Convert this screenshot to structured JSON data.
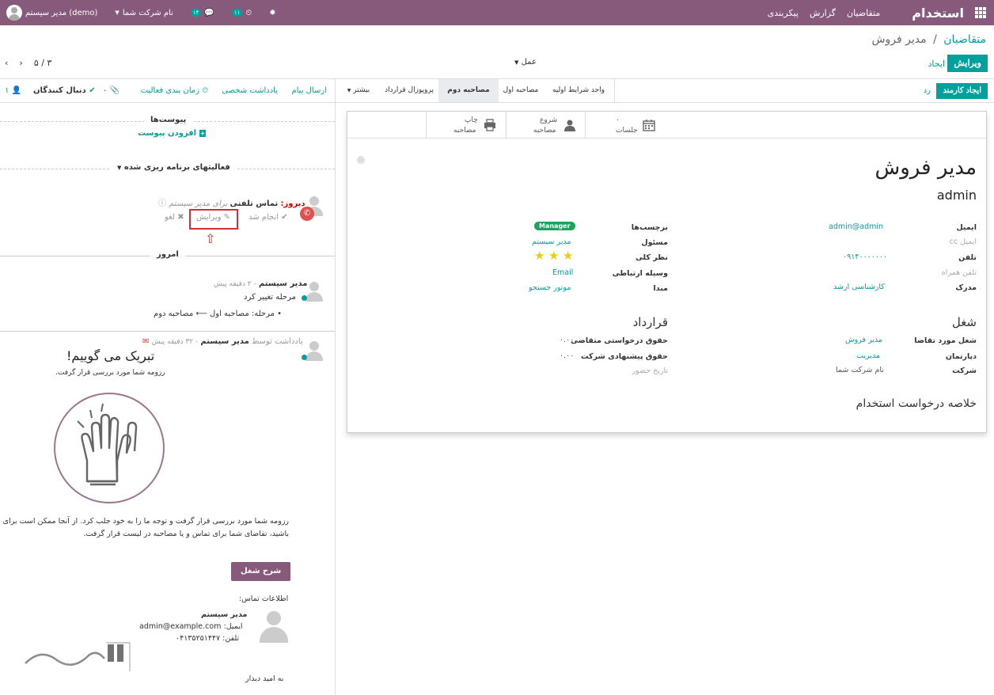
{
  "navbar": {
    "brand": "استخدام",
    "menu": [
      "متقاضیان",
      "گزارش",
      "پیکربندی"
    ],
    "company": "نام شرکت شما",
    "user": "مدیر سیستم (demo)",
    "messages_badge": "۱۴",
    "activities_badge": "۱۱"
  },
  "control": {
    "breadcrumb_parent": "متقاضیان",
    "breadcrumb_sep": "/",
    "breadcrumb_current": "مدیر فروش",
    "edit_label": "ویرایش",
    "create_label": "ایجاد",
    "action_label": "عمل",
    "pager": "۵ / ۳"
  },
  "statusbar": {
    "create_employee": "ایجاد کارمند",
    "refuse": "رد",
    "stages": [
      "واجد شرایط اولیه",
      "مصاحبه اول",
      "مصاحبه دوم",
      "پروپوزال قرارداد",
      "بیشتر"
    ],
    "active_stage": "مصاحبه دوم"
  },
  "smart_buttons": {
    "meetings_count": "۰",
    "meetings_label": "جلسات",
    "start_label1": "شروع",
    "start_label2": "مصاحبه",
    "print_label1": "چاپ",
    "print_label2": "مصاحبه"
  },
  "form": {
    "title": "مدیر فروش",
    "subject": "admin",
    "email_label": "ایمیل",
    "email_value": "admin@admin",
    "email_cc_label": "ایمیل cc",
    "phone_label": "تلفن",
    "phone_value": "۰۹۱۴۰۰۰۰۰۰۰",
    "mobile_label": "تلفن همراه",
    "degree_label": "مدرک",
    "degree_value": "کارشناسی ارشد",
    "tags_label": "برچسب‌ها",
    "tag_value": "Manager",
    "responsible_label": "مسئول",
    "responsible_value": "مدیر سیستم",
    "evaluation_label": "نظر کلی",
    "evaluation_stars": 3,
    "medium_label": "وسیله ارتباطی",
    "medium_value": "Email",
    "source_label": "مبدا",
    "source_value": "موتور جستجو",
    "job_section": "شغل",
    "job_label": "شغل مورد تقاضا",
    "job_value": "مدیر فروش",
    "department_label": "دپارتمان",
    "department_value": "مدیریت",
    "company_label": "شرکت",
    "company_value": "نام شرکت شما",
    "contract_section": "قرارداد",
    "expected_salary_label": "حقوق درخواستی متقاضی",
    "expected_salary_value": "۰.۰۰",
    "proposed_salary_label": "حقوق پیشنهادی شرکت",
    "proposed_salary_value": "۰.۰۰",
    "availability_label": "تاریخ حضور",
    "summary_section": "خلاصه درخواست استخدام"
  },
  "chatter": {
    "send_message": "ارسال پیام",
    "log_note": "یادداشت شخصی",
    "schedule_activity": "زمان بندی فعالیت",
    "attachments_count": "۰",
    "follow": "دنبال کنندگان",
    "followers_count": "۱",
    "attachments_title": "پیوست‌ها",
    "add_attachment": "افزودن پیوست",
    "planned_activities": "فعالیتهای برنامه ریزی شده",
    "activity_when": "دیروز:",
    "activity_title": "تماس تلفنی",
    "activity_for": "برای مدیر سیستم",
    "act_done": "انجام شد",
    "act_edit": "ویرایش",
    "act_cancel": "لغو",
    "today": "امروز",
    "msg1_author": "مدیر سیستم",
    "msg1_time": "- ۲ دقیقه پیش",
    "msg1_body": "مرحله تغییر کرد",
    "msg1_change": "مرحله: مصاحبه اول ⟵ مصاحبه دوم",
    "msg2_prefix": "یادداشت توسط",
    "msg2_author": "مدیر سیستم",
    "msg2_time": "- ۳۲ دقیقه پیش",
    "congrats_title": "تبریک می گوییم!",
    "congrats_sub": "رزومه شما مورد بررسی قرار گرفت.",
    "body_line1": "رزومه شما مورد بررسی قرار گرفت و توجه ما را به خود جلب کرد. از آنجا ممکن است برای ا",
    "body_line2": "باشید، تقاضای شما برای تماس و یا مصاحبه در لیست قرار گرفت.",
    "job_desc_btn": "شرح شغل",
    "contact_info": "اطلاعات تماس:",
    "contact_name": "مدیر سیستم",
    "contact_email_label": "ایمیل:",
    "contact_email": "admin@example.com",
    "contact_phone_label": "تلفن:",
    "contact_phone": "۰۴۱۳۵۲۵۱۴۴۷",
    "closing": "به امید دیدار"
  },
  "colors": {
    "brand": "#875A7B",
    "accent": "#00A09D",
    "tag": "#1CA35C",
    "star": "#f3cc00",
    "highlight_box": "#d32f2f"
  }
}
